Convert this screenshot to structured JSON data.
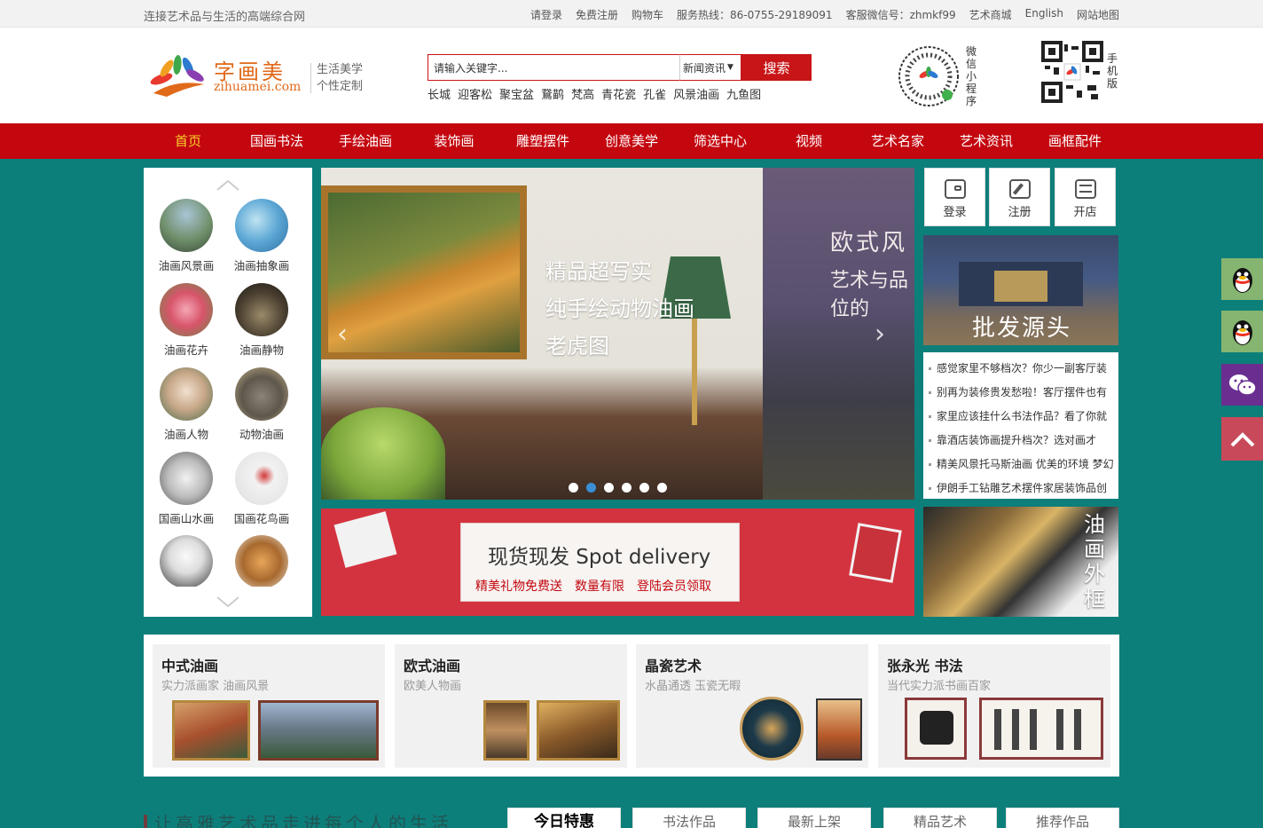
{
  "topbar": {
    "slogan": "连接艺术品与生活的高端综合网",
    "links": [
      "请登录",
      "免费注册",
      "购物车",
      "服务热线：86-0755-29189091",
      "客服微信号：zhmkf99",
      "艺术商城",
      "English",
      "网站地图"
    ]
  },
  "header": {
    "logo_cn": "字画美",
    "logo_en": "zihuamei.com",
    "tagline_1": "生活美学",
    "tagline_2": "个性定制",
    "search_placeholder": "请输入关键字...",
    "search_scope": "新闻资讯",
    "search_button": "搜索",
    "hotwords": [
      "长城",
      "迎客松",
      "聚宝盆",
      "鵞鹋",
      "梵高",
      "青花瓷",
      "孔雀",
      "风景油画",
      "九鱼图"
    ],
    "qr_label_1": "微信小程序",
    "qr_label_2": "手机版"
  },
  "nav": {
    "items": [
      "首页",
      "国画书法",
      "手绘油画",
      "装饰画",
      "雕塑摆件",
      "创意美学",
      "筛选中心",
      "视频",
      "艺术名家",
      "艺术资讯",
      "画框配件"
    ],
    "active_color": "#f7d12a"
  },
  "categories": [
    {
      "label": "油画风景画",
      "icon": "landscape-painting-icon"
    },
    {
      "label": "油画抽象画",
      "icon": "abstract-painting-icon"
    },
    {
      "label": "油画花卉",
      "icon": "flower-painting-icon"
    },
    {
      "label": "油画静物",
      "icon": "still-life-icon"
    },
    {
      "label": "油画人物",
      "icon": "figure-painting-icon"
    },
    {
      "label": "动物油画",
      "icon": "animal-painting-icon"
    },
    {
      "label": "国画山水画",
      "icon": "ink-landscape-icon"
    },
    {
      "label": "国画花鸟画",
      "icon": "bird-flower-icon"
    }
  ],
  "slider": {
    "main_text": [
      "精品超写实",
      "纯手绘动物油画",
      "老虎图"
    ],
    "second_title": "欧式风",
    "second_sub": "艺术与品位的",
    "dots_total": 6,
    "dots_active": 1
  },
  "quick_actions": [
    {
      "label": "登录",
      "icon": "wallet-icon"
    },
    {
      "label": "注册",
      "icon": "edit-icon"
    },
    {
      "label": "开店",
      "icon": "exchange-icon"
    }
  ],
  "wholesale": {
    "text": "批发源头"
  },
  "news": [
    "感觉家里不够档次？你少一副客厅装",
    "别再为装修贵发愁啦！客厅摆件也有",
    "家里应该挂什么书法作品？看了你就",
    "靠酒店装饰画提升档次？选对画才",
    "精美风景托马斯油画 优美的环境 梦幻",
    "伊朗手工钻雕艺术摆件家居装饰品创"
  ],
  "banner": {
    "title": "现货现发 Spot delivery",
    "sub": "精美礼物免费送　数量有限　登陆会员领取"
  },
  "frames": {
    "text": "油画外框"
  },
  "featured": [
    {
      "title": "中式油画",
      "sub": "实力派画家 油画风景"
    },
    {
      "title": "欧式油画",
      "sub": "欧美人物画"
    },
    {
      "title": "晶瓷艺术",
      "sub": "水晶通透 玉瓷无暇"
    },
    {
      "title": "张永光 书法",
      "sub": "当代实力派书画百家"
    }
  ],
  "bottom": {
    "slogan": "让高雅艺术品走进每个人的生活",
    "tabs": [
      "今日特惠",
      "书法作品",
      "最新上架",
      "精品艺术",
      "推荐作品"
    ]
  },
  "colors": {
    "brand_red": "#c4070f",
    "page_teal": "#0d7f7b"
  }
}
